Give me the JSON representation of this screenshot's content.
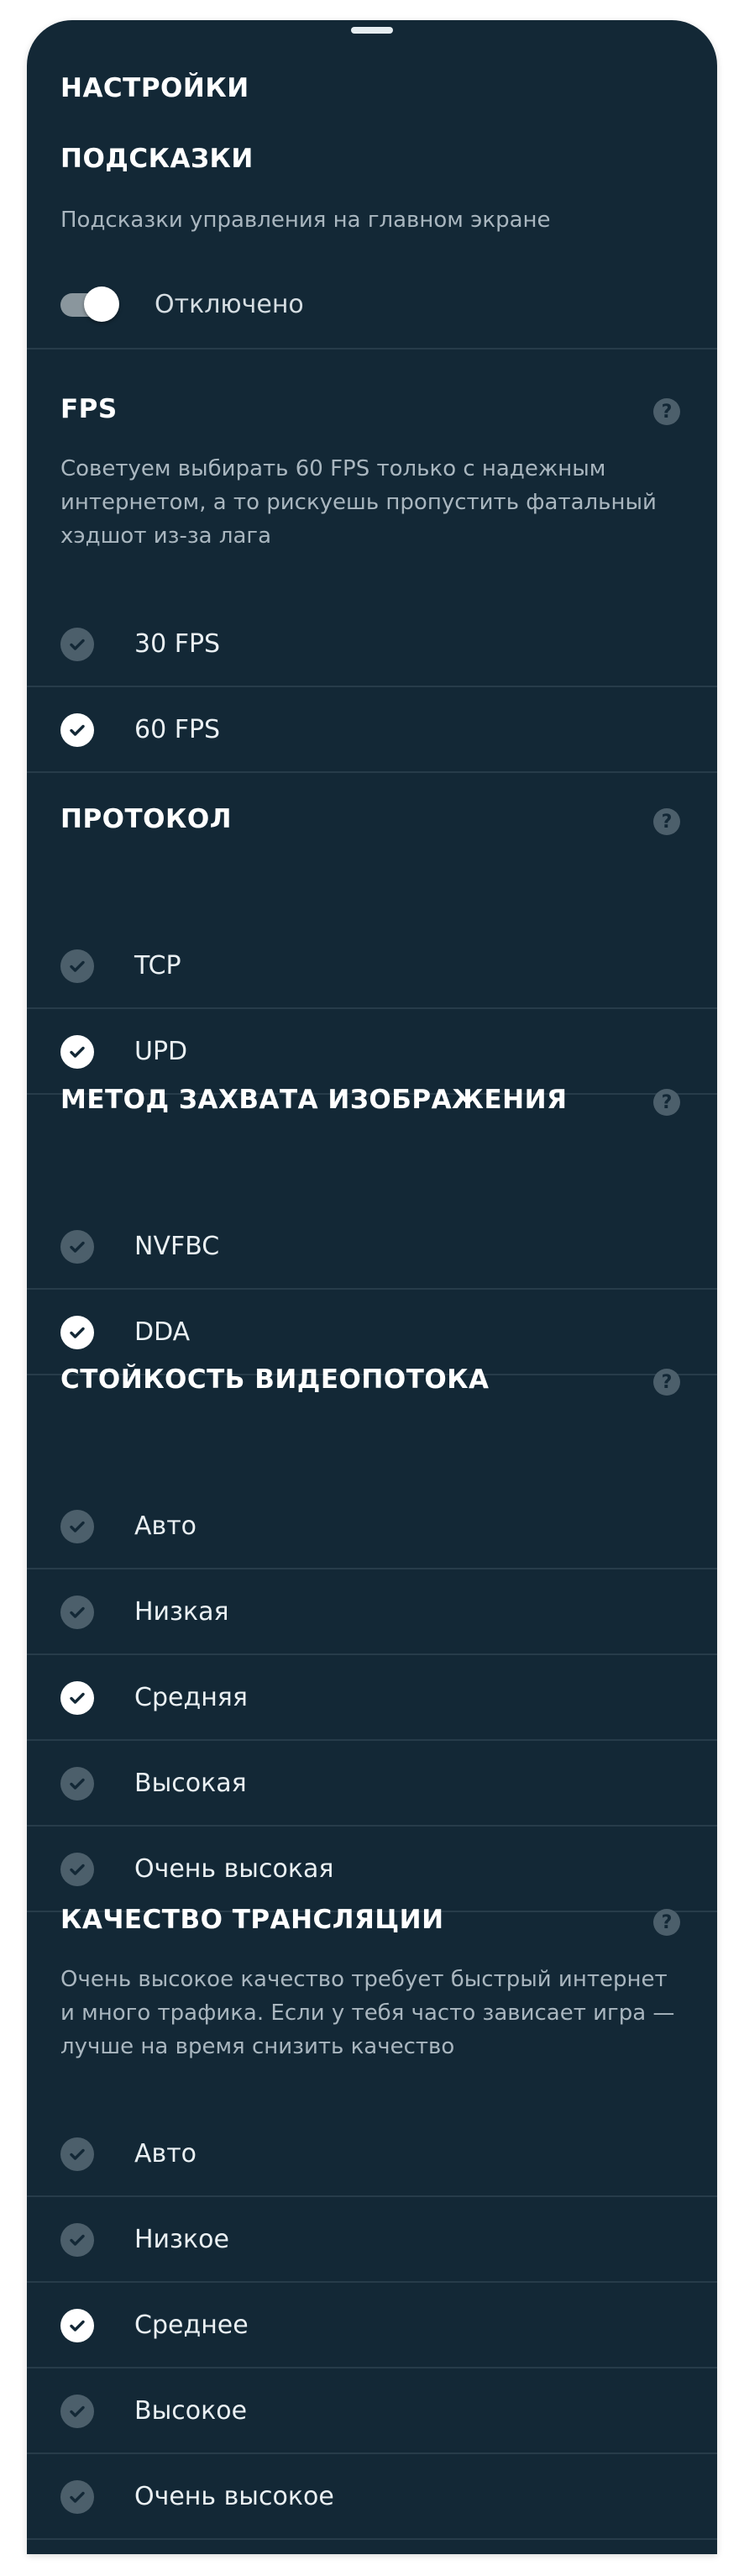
{
  "title": "НАСТРОЙКИ",
  "hints": {
    "title": "ПОДСКАЗКИ",
    "description": "Подсказки управления на главном экране",
    "toggle_label": "Отключено"
  },
  "fps": {
    "title": "FPS",
    "help_icon": "question-icon",
    "description": "Советуем выбирать 60 FPS только с надежным интернетом, а то рискуешь пропустить фатальный хэдшот из-за лага",
    "options": [
      {
        "label": "30 FPS",
        "selected": false
      },
      {
        "label": "60 FPS",
        "selected": true
      }
    ]
  },
  "protocol": {
    "title": "ПРОТОКОЛ",
    "options": [
      {
        "label": "TCP",
        "selected": false
      },
      {
        "label": "UPD",
        "selected": true
      }
    ]
  },
  "capture": {
    "title": "МЕТОД ЗАХВАТА ИЗОБРАЖЕНИЯ",
    "options": [
      {
        "label": "NVFBC",
        "selected": false
      },
      {
        "label": "DDA",
        "selected": true
      }
    ]
  },
  "stability": {
    "title": "СТОЙКОСТЬ ВИДЕОПОТОКА",
    "options": [
      {
        "label": "Авто",
        "selected": false
      },
      {
        "label": "Низкая",
        "selected": false
      },
      {
        "label": "Средняя",
        "selected": true
      },
      {
        "label": "Высокая",
        "selected": false
      },
      {
        "label": "Очень высокая",
        "selected": false
      }
    ]
  },
  "quality": {
    "title": "КАЧЕСТВО ТРАНСЛЯЦИИ",
    "description": "Очень высокое качество требует быстрый интернет и много трафика. Если у тебя часто зависает игра — лучше на время снизить качество",
    "options": [
      {
        "label": "Авто",
        "selected": false
      },
      {
        "label": "Низкое",
        "selected": false
      },
      {
        "label": "Среднее",
        "selected": true
      },
      {
        "label": "Высокое",
        "selected": false
      },
      {
        "label": "Очень высокое",
        "selected": false
      }
    ]
  },
  "colors": {
    "background": "#132836",
    "divider": "#273c4a",
    "inactive_check": "#4c5f6b",
    "active_check": "#ffffff"
  }
}
